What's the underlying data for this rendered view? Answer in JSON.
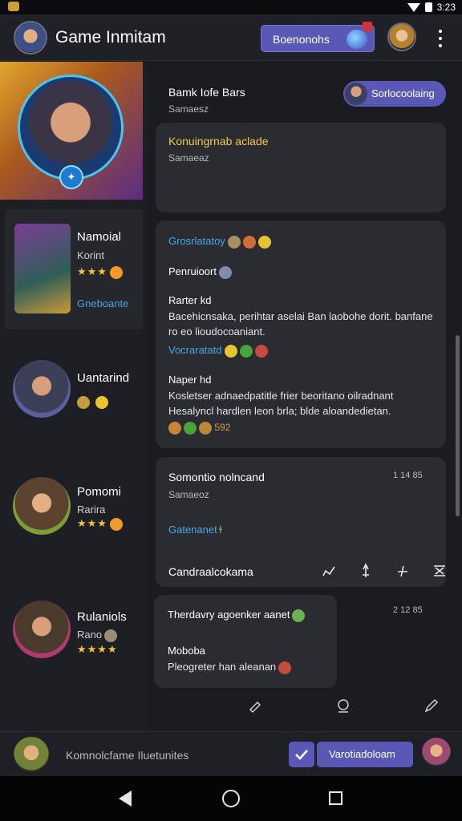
{
  "status_bar": {
    "time": "3:23"
  },
  "app_bar": {
    "title": "Game Inmitam",
    "primary_button_label": "Boenonohs",
    "icons": [
      "app-avatar-icon",
      "orb-icon",
      "user-avatar-icon",
      "more-vert-icon"
    ]
  },
  "champions": [
    {
      "name": "Namoial",
      "sub": "Korint",
      "stars": "★★★",
      "link": "Gneboante",
      "selected": true
    },
    {
      "name": "Uantarind",
      "sub": "",
      "stars": "",
      "link": "",
      "selected": false
    },
    {
      "name": "Pomomi",
      "sub": "Rarira",
      "stars": "★★★",
      "link": "",
      "selected": false
    },
    {
      "name": "Rulaniols",
      "sub": "Rano",
      "stars": "★★★★",
      "link": "",
      "selected": false
    }
  ],
  "header_block": {
    "title": "Bamk Iofe Bars",
    "subtitle": "Samaesz",
    "action_label": "Sorlocoolaing"
  },
  "notice_card": {
    "title": "Konuingrnab aclade",
    "subtitle": "Samaeaz"
  },
  "detail_card": {
    "category": "Grosrlatatoy",
    "section1_label": "Penruioort",
    "section2_title": "Rarter kd",
    "section2_body": "Bacehicnsaka, perihtar aselai Ban laobohe dorit. banfane ro eo lioudocoaniant.",
    "section2_link": "Vocraratatd",
    "section3_title": "Naper hd",
    "section3_body": "Kosletser adnaedpatitle frier beoritano oilradnant Hesalyncl hardlen leon brla; blde aloandedietan.",
    "section3_count": "592"
  },
  "mission_card": {
    "title": "Somontio nolncand",
    "subtitle": "Samaeoz",
    "meta": "1 14 85",
    "link": "Gatenanet",
    "footer_label": "Candraalcokama"
  },
  "message_bubble": {
    "title": "Therdavry agoenker aanet",
    "meta": "2 12 85",
    "section_title": "Moboba",
    "body": "Pleogreter han aleanan"
  },
  "composer": {
    "placeholder": "Komnolcfame Iluetunites",
    "send_label": "Varotiadoloam"
  },
  "colors": {
    "accent": "#5a58b6",
    "link": "#45a7e8",
    "star": "#f1c636",
    "gold_title": "#f0c84a"
  }
}
